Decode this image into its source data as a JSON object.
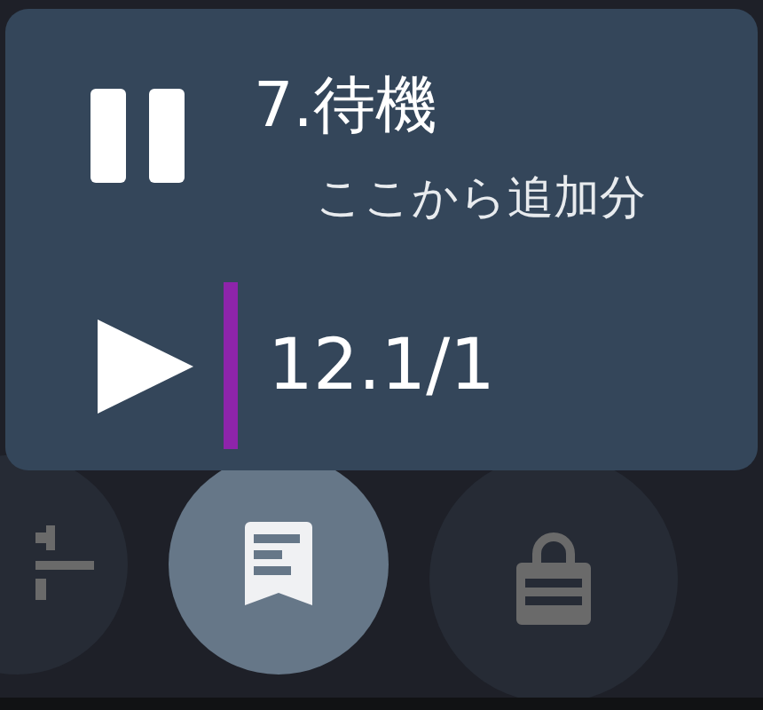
{
  "status_popup": {
    "kind": "pause",
    "title": "7.待機",
    "subtitle": "ここから追加分",
    "position": "12.1/1"
  },
  "bottom_buttons": [
    {
      "kind": "tune",
      "selected": false
    },
    {
      "kind": "bookmark",
      "selected": true
    },
    {
      "kind": "lock",
      "selected": false
    }
  ]
}
